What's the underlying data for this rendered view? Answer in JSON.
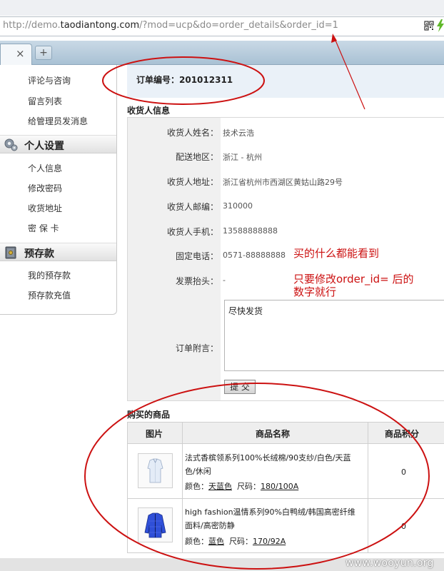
{
  "browser": {
    "url_prefix": "http://demo.",
    "url_host": "taodiantong.com",
    "url_rest": "/?mod=ucp&do=order_details&order_id=1",
    "tab_close": "×",
    "new_tab": "+"
  },
  "sidebar": {
    "top_items": [
      "评论与咨询",
      "留言列表",
      "给管理员发消息"
    ],
    "sections": [
      {
        "title": "个人设置",
        "icon": "gear-icon",
        "items": [
          "个人信息",
          "修改密码",
          "收货地址",
          "密 保 卡"
        ]
      },
      {
        "title": "预存款",
        "icon": "safe-icon",
        "items": [
          "我的预存款",
          "预存款充值"
        ]
      }
    ]
  },
  "order": {
    "number_label": "订单编号：201012311"
  },
  "consignee": {
    "title": "收货人信息",
    "fields": [
      {
        "label": "收货人姓名：",
        "value": "技术云浩"
      },
      {
        "label": "配送地区：",
        "value": "浙江 - 杭州"
      },
      {
        "label": "收货人地址：",
        "value": "浙江省杭州市西湖区黄姑山路29号"
      },
      {
        "label": "收货人邮编：",
        "value": "310000"
      },
      {
        "label": "收货人手机：",
        "value": "13588888888"
      },
      {
        "label": "固定电话：",
        "value": "0571-88888888"
      },
      {
        "label": "发票抬头：",
        "value": "-"
      }
    ],
    "remark_label": "订单附言：",
    "remark_value": "尽快发货",
    "submit_label": "提 交"
  },
  "annotations": {
    "line1": "买的什么都能看到",
    "line2": "只要修改order_id= 后的",
    "line3": "数字就行",
    "color": "#cc1111"
  },
  "products": {
    "title": "购买的商品",
    "headers": [
      "图片",
      "商品名称",
      "商品积分"
    ],
    "rows": [
      {
        "name_line1": "法式香槟领系列100%长绒棉/90支纱/白色/天蓝",
        "name_line2": "色/休闲",
        "color_label": "颜色：",
        "color_value": "天蓝色",
        "size_label": "尺码：",
        "size_value": "180/100A",
        "points": "0",
        "image": "shirt-image"
      },
      {
        "name_line1": "high fashion温情系列90%白鸭绒/韩国高密纤维",
        "name_line2": "面料/高密防静",
        "color_label": "颜色：",
        "color_value": "蓝色",
        "size_label": "尺码：",
        "size_value": "170/92A",
        "points": "0",
        "image": "down-jacket-image"
      }
    ]
  },
  "footer": {
    "watermark": "www.wooyun.org"
  }
}
